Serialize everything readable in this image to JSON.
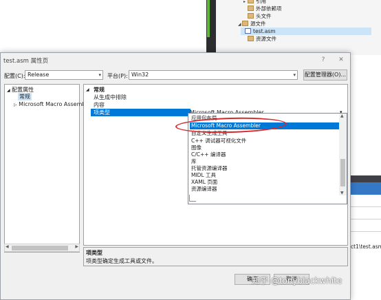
{
  "explorer": {
    "items": [
      {
        "label": "引用",
        "type": "ref",
        "level": 0
      },
      {
        "label": "外部依赖项",
        "type": "folder",
        "level": 0
      },
      {
        "label": "头文件",
        "type": "folder",
        "level": 0
      },
      {
        "label": "源文件",
        "type": "folder",
        "level": 0
      },
      {
        "label": "test.asm",
        "type": "file",
        "level": 1
      },
      {
        "label": "资源文件",
        "type": "folder",
        "level": 0
      }
    ]
  },
  "background": {
    "path_fragment": "ct1\\test.asm"
  },
  "dialog": {
    "title": "test.asm 属性页",
    "help_glyph": "?",
    "close_glyph": "✕",
    "config_label": "配置(C):",
    "config_value": "Release",
    "platform_label": "平台(P):",
    "platform_value": "Win32",
    "config_manager_label": "配置管理器(O)...",
    "ok_label": "确定",
    "cancel_label": "取消"
  },
  "tree": {
    "root": "配置属性",
    "items": [
      "常规",
      "Microsoft Macro Assembler"
    ]
  },
  "grid": {
    "category": "常规",
    "rows": [
      {
        "name": "从生成中排除",
        "value": ""
      },
      {
        "name": "内容",
        "value": ""
      },
      {
        "name": "项类型",
        "value": "Microsoft Macro Assembler"
      }
    ]
  },
  "dropdown": {
    "selected_index": 1,
    "options": [
      "应用包布局",
      "Microsoft Macro Assembler",
      "自定义生成工具",
      "C++ 调试器可视化文件",
      "图像",
      "C/C++ 编译器",
      "库",
      "托管资源编译器",
      "MIDL 工具",
      "XAML 页面",
      "资源编译器"
    ]
  },
  "description": {
    "title": "项类型",
    "text": "项类型确定生成工具或文件。"
  },
  "watermark": {
    "text": "知乎 @tonyblackwhite"
  },
  "colors": {
    "accent": "#0078d7",
    "annotation": "#d7282f",
    "ide_dark": "#2d2d30"
  }
}
